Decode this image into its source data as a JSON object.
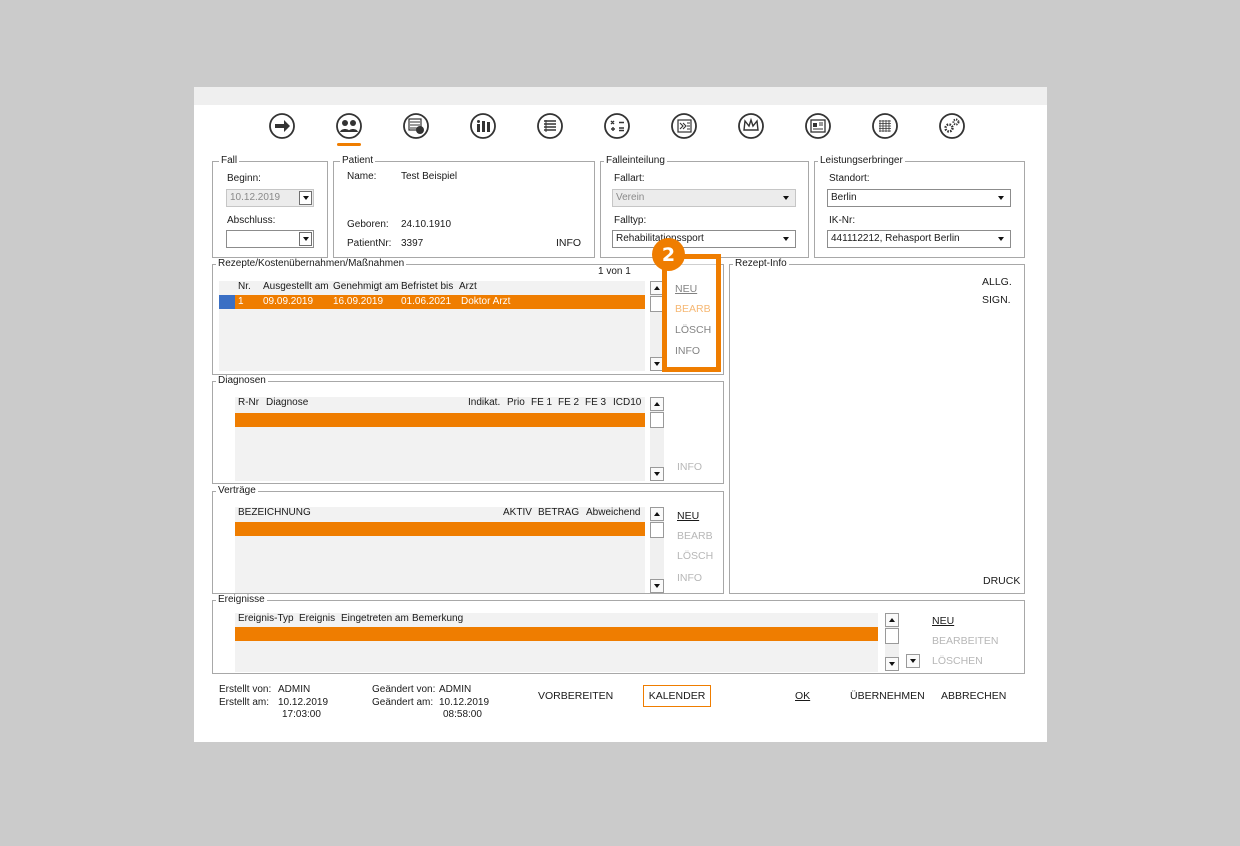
{
  "colors": {
    "accent": "#ef7d00",
    "selection": "#3a6fc4",
    "background": "#cbcbcb"
  },
  "toolbar": {
    "icons": [
      "arrow-right-icon",
      "patients-icon",
      "calendar-clock-icon",
      "statistics-icon",
      "invoice-list-icon",
      "calculator-icon",
      "export-icon",
      "crown-icon",
      "id-card-icon",
      "calendar-grid-icon",
      "settings-gears-icon"
    ],
    "active_index": 1
  },
  "fall": {
    "title": "Fall",
    "beginn_label": "Beginn:",
    "beginn_value": "10.12.2019",
    "abschluss_label": "Abschluss:",
    "abschluss_value": ""
  },
  "patient": {
    "title": "Patient",
    "name_label": "Name:",
    "name_value": "Test Beispiel",
    "geboren_label": "Geboren:",
    "geboren_value": "24.10.1910",
    "patientnr_label": "PatientNr:",
    "patientnr_value": "3397",
    "info_label": "INFO"
  },
  "falleinteilung": {
    "title": "Falleinteilung",
    "fallart_label": "Fallart:",
    "fallart_value": "Verein",
    "falltyp_label": "Falltyp:",
    "falltyp_value": "Rehabilitationssport"
  },
  "leistungserbringer": {
    "title": "Leistungserbringer",
    "standort_label": "Standort:",
    "standort_value": "Berlin",
    "ik_label": "IK-Nr:",
    "ik_value": "441112212, Rehasport Berlin"
  },
  "rezepte": {
    "title": "Rezepte/Kostenübernahmen/Maßnahmen",
    "pager": "1 von 1",
    "headers": [
      "Nr.",
      "Ausgestellt am",
      "Genehmigt am",
      "Befristet bis",
      "Arzt"
    ],
    "rows": [
      [
        "1",
        "09.09.2019",
        "16.09.2019",
        "01.06.2021",
        "Doktor Arzt"
      ]
    ],
    "actions": {
      "neu": "NEU",
      "bearb": "BEARB",
      "loesch": "LÖSCH",
      "info": "INFO"
    }
  },
  "callout": {
    "number": "2"
  },
  "rezept_info": {
    "title": "Rezept-Info",
    "allg": "ALLG.",
    "sign": "SIGN.",
    "druck": "DRUCK"
  },
  "diagnosen": {
    "title": "Diagnosen",
    "headers": [
      "R-Nr",
      "Diagnose",
      "Indikat.",
      "Prio",
      "FE 1",
      "FE 2",
      "FE 3",
      "ICD10"
    ],
    "info": "INFO"
  },
  "vertraege": {
    "title": "Verträge",
    "headers": [
      "BEZEICHNUNG",
      "AKTIV",
      "BETRAG",
      "Abweichend"
    ],
    "actions": {
      "neu": "NEU",
      "bearb": "BEARB",
      "loesch": "LÖSCH",
      "info": "INFO"
    }
  },
  "ereignisse": {
    "title": "Ereignisse",
    "headers": [
      "Ereignis-Typ",
      "Ereignis",
      "Eingetreten am",
      "Bemerkung"
    ],
    "actions": {
      "neu": "NEU",
      "bearbeiten": "BEARBEITEN",
      "loeschen": "LÖSCHEN"
    }
  },
  "footer": {
    "erstellt_von_label": "Erstellt von:",
    "erstellt_von_value": "ADMIN",
    "erstellt_am_label": "Erstellt am:",
    "erstellt_am_date": "10.12.2019",
    "erstellt_am_time": "17:03:00",
    "geaendert_von_label": "Geändert von:",
    "geaendert_von_value": "ADMIN",
    "geaendert_am_label": "Geändert am:",
    "geaendert_am_date": "10.12.2019",
    "geaendert_am_time": "08:58:00",
    "vorbereiten": "VORBEREITEN",
    "kalender": "KALENDER",
    "ok": "OK",
    "uebernehmen": "ÜBERNEHMEN",
    "abbrechen": "ABBRECHEN"
  }
}
